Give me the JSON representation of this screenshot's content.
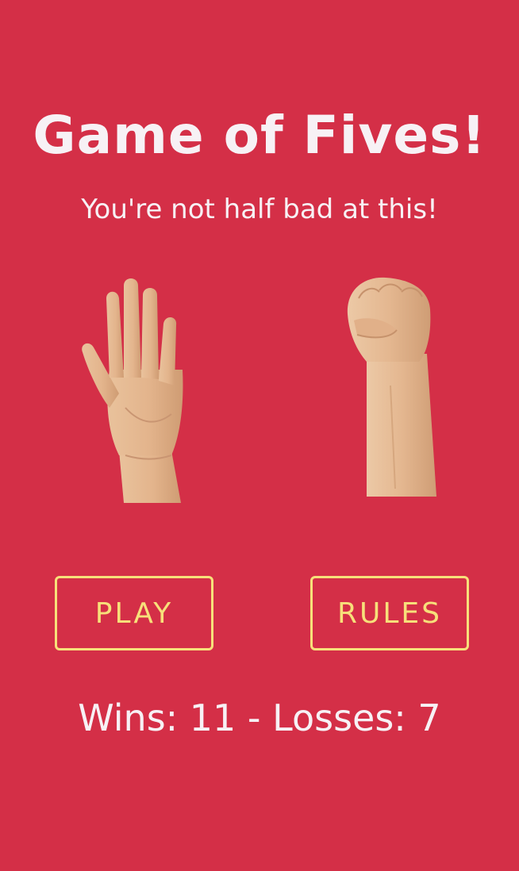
{
  "game": {
    "title": "Game of Fives!",
    "subtitle": "You're not half bad at this!"
  },
  "hands": {
    "left": {
      "icon": "open-hand-icon",
      "gesture": "five"
    },
    "right": {
      "icon": "fist-icon",
      "gesture": "zero"
    }
  },
  "buttons": {
    "play_label": "PLAY",
    "rules_label": "RULES"
  },
  "score": {
    "text": "Wins: 11 - Losses: 7",
    "wins": 11,
    "losses": 7
  },
  "colors": {
    "background": "#d42f47",
    "text": "#f7f1f5",
    "accent": "#f7e07a",
    "skin": "#e8bf98"
  }
}
